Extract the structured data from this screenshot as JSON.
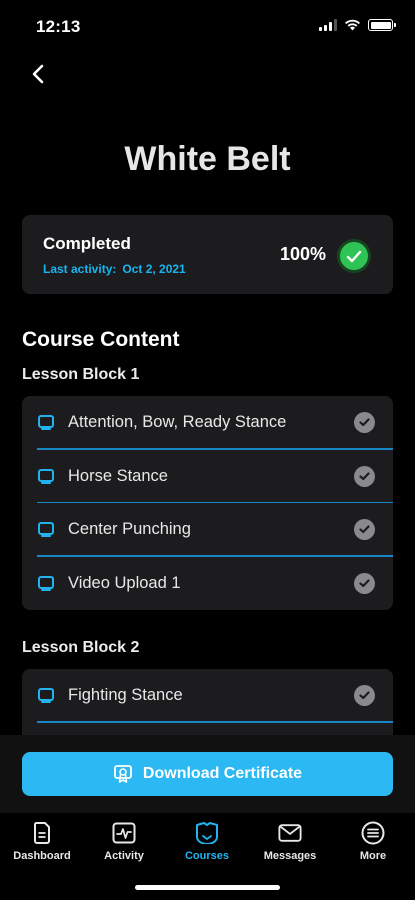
{
  "status_bar": {
    "time": "12:13"
  },
  "page": {
    "title": "White Belt"
  },
  "progress": {
    "status": "Completed",
    "last_activity_label": "Last activity:",
    "last_activity_date": "Oct 2, 2021",
    "percent_label": "100%",
    "percent_value": 100
  },
  "course_content": {
    "title": "Course Content",
    "blocks": [
      {
        "label": "Lesson Block 1",
        "lessons": [
          {
            "label": "Attention, Bow, Ready Stance",
            "completed": true
          },
          {
            "label": "Horse Stance",
            "completed": true
          },
          {
            "label": "Center Punching",
            "completed": true
          },
          {
            "label": "Video Upload 1",
            "completed": true
          }
        ]
      },
      {
        "label": "Lesson Block 2",
        "lessons": [
          {
            "label": "Fighting Stance",
            "completed": true
          }
        ]
      }
    ]
  },
  "actions": {
    "download_label": "Download Certificate"
  },
  "tabs": [
    {
      "label": "Dashboard",
      "icon": "document-icon",
      "active": false
    },
    {
      "label": "Activity",
      "icon": "activity-icon",
      "active": false
    },
    {
      "label": "Courses",
      "icon": "courses-icon",
      "active": true
    },
    {
      "label": "Messages",
      "icon": "envelope-icon",
      "active": false
    },
    {
      "label": "More",
      "icon": "menu-circle-icon",
      "active": false
    }
  ],
  "colors": {
    "accent": "#22b3ef",
    "button": "#2cb8f2",
    "success": "#2fc254",
    "card": "#1c1c1e",
    "divider": "#1587c2",
    "check_gray": "#8a8a8e"
  }
}
